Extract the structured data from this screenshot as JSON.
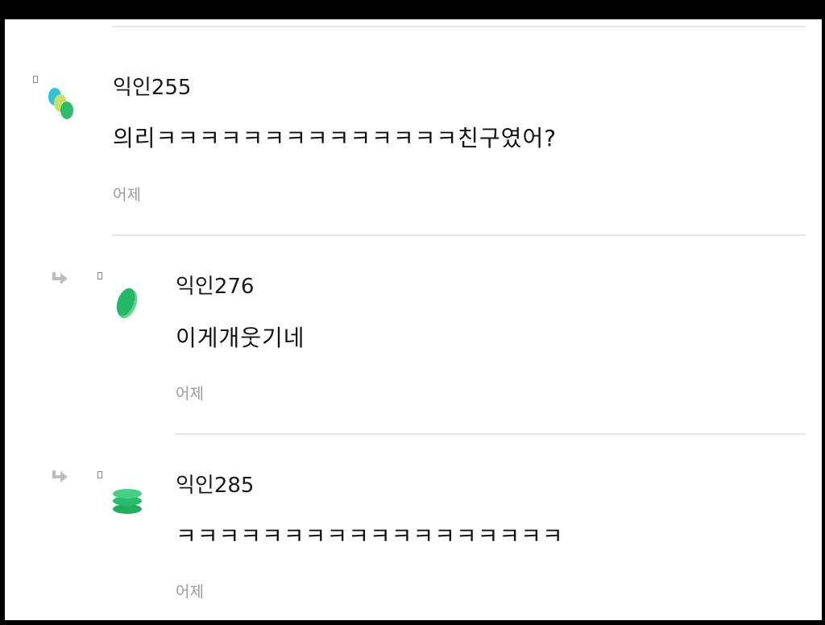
{
  "comments": [
    {
      "nickname": "익인255",
      "body": "의리ㅋㅋㅋㅋㅋㅋㅋㅋㅋㅋㅋㅋㅋㅋ친구였어?",
      "time": "어제",
      "avatar": "dots-avatar-icon",
      "is_reply": false
    },
    {
      "nickname": "익인276",
      "body": "이게개웃기네",
      "time": "어제",
      "avatar": "green-disc-avatar-icon",
      "is_reply": true
    },
    {
      "nickname": "익인285",
      "body": "ㅋㅋㅋㅋㅋㅋㅋㅋㅋㅋㅋㅋㅋㅋㅋㅋㅋㅋ",
      "time": "어제",
      "avatar": "green-stack-avatar-icon",
      "is_reply": true
    }
  ],
  "colors": {
    "background": "#ffffff",
    "frame": "#000000",
    "divider": "#e6e6e6",
    "time_text": "#9a9a9a",
    "avatar_teal": "#2ec4d6",
    "avatar_lime": "#c7e06b",
    "avatar_green": "#2ebd6b"
  }
}
